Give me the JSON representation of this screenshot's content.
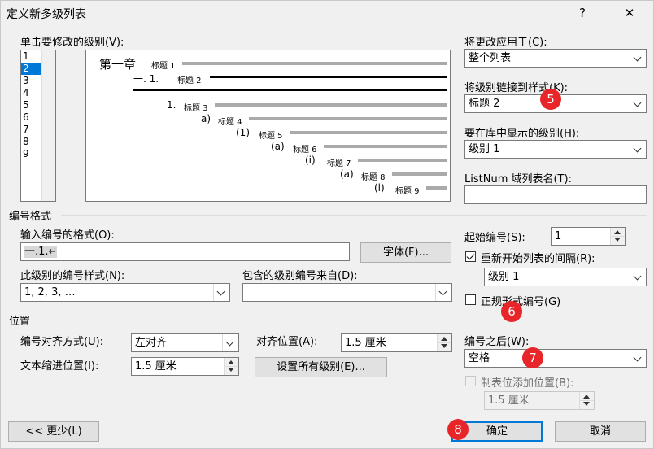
{
  "window": {
    "title": "定义新多级列表",
    "help": "?",
    "close": "✕"
  },
  "levels": {
    "label": "单击要修改的级别(V):",
    "items": [
      "1",
      "2",
      "3",
      "4",
      "5",
      "6",
      "7",
      "8",
      "9"
    ],
    "selected": "2"
  },
  "preview": {
    "chapter": "第一章",
    "rows": [
      {
        "num": "",
        "tag": "标题 1"
      },
      {
        "num": "一. 1.",
        "tag": "标题 2"
      },
      {
        "num": "1.",
        "tag": "标题 3"
      },
      {
        "num": "a)",
        "tag": "标题 4"
      },
      {
        "num": "(1)",
        "tag": "标题 5"
      },
      {
        "num": "(a)",
        "tag": "标题 6"
      },
      {
        "num": "(i)",
        "tag": "标题 7"
      },
      {
        "num": "(a)",
        "tag": "标题 8"
      },
      {
        "num": "(i)",
        "tag": "标题 9"
      }
    ]
  },
  "apply_to": {
    "label": "将更改应用于(C):",
    "value": "整个列表"
  },
  "link_style": {
    "label": "将级别链接到样式(K):",
    "value": "标题 2"
  },
  "gallery_level": {
    "label": "要在库中显示的级别(H):",
    "value": "级别 1"
  },
  "listnum": {
    "label": "ListNum 域列表名(T):",
    "value": ""
  },
  "number_format": {
    "section": "编号格式",
    "format_label": "输入编号的格式(O):",
    "format_value": "一.1.↵",
    "font_button": "字体(F)...",
    "style_label": "此级别的编号样式(N):",
    "style_value": "1, 2, 3, …",
    "include_label": "包含的级别编号来自(D):",
    "include_value": "",
    "start_label": "起始编号(S):",
    "start_value": "1",
    "restart_label": "重新开始列表的间隔(R):",
    "restart_checked": true,
    "restart_value": "级别 1",
    "legal_label": "正规形式编号(G)",
    "legal_checked": false
  },
  "position": {
    "section": "位置",
    "align_label": "编号对齐方式(U):",
    "align_value": "左对齐",
    "align_at_label": "对齐位置(A):",
    "align_at_value": "1.5 厘米",
    "indent_label": "文本缩进位置(I):",
    "indent_value": "1.5 厘米",
    "set_all_button": "设置所有级别(E)...",
    "follow_label": "编号之后(W):",
    "follow_value": "空格",
    "tab_label": "制表位添加位置(B):",
    "tab_checked": false,
    "tab_value": "1.5 厘米"
  },
  "footer": {
    "less_button": "<< 更少(L)",
    "ok_button": "确定",
    "cancel_button": "取消"
  },
  "badges": {
    "b5": "5",
    "b6": "6",
    "b7": "7",
    "b8": "8"
  },
  "colors": {
    "accent": "#0078d7",
    "badge": "#e8262a"
  }
}
